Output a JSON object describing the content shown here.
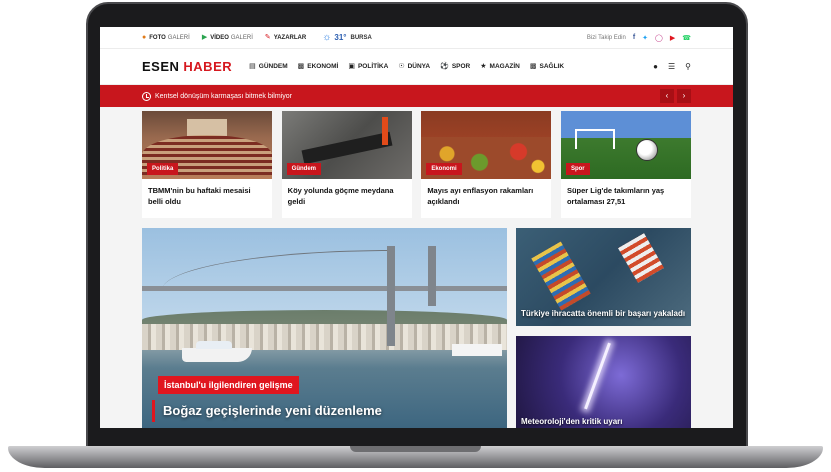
{
  "topbar": {
    "links": [
      {
        "icon": "camera-icon",
        "label": "FOTO",
        "sub": "GALERİ"
      },
      {
        "icon": "play-icon",
        "label": "VİDEO",
        "sub": "GALERİ"
      },
      {
        "icon": "pen-icon",
        "label": "YAZARLAR",
        "sub": ""
      }
    ],
    "weather": {
      "temp": "31°",
      "city": "BURSA"
    },
    "follow_label": "Bizi Takip Edin",
    "social": [
      "facebook-icon",
      "twitter-icon",
      "instagram-icon",
      "youtube-icon",
      "whatsapp-icon"
    ]
  },
  "header": {
    "logo_part1": "ESEN",
    "logo_part2": "HABER",
    "nav": [
      {
        "icon": "newspaper-icon",
        "label": "GÜNDEM"
      },
      {
        "icon": "chart-icon",
        "label": "EKONOMİ"
      },
      {
        "icon": "ballot-icon",
        "label": "POLİTİKA"
      },
      {
        "icon": "globe-icon",
        "label": "DÜNYA"
      },
      {
        "icon": "football-icon",
        "label": "SPOR"
      },
      {
        "icon": "star-icon",
        "label": "MAGAZİN"
      },
      {
        "icon": "medkit-icon",
        "label": "SAĞLIK"
      }
    ]
  },
  "breaking": {
    "text": "Kentsel dönüşüm karmaşası bitmek bilmiyor",
    "prev": "‹",
    "next": "›"
  },
  "cards": [
    {
      "category": "Politika",
      "title": "TBMM'nin bu haftaki mesaisi belli oldu"
    },
    {
      "category": "Gündem",
      "title": "Köy yolunda göçme meydana geldi"
    },
    {
      "category": "Ekonomi",
      "title": "Mayıs ayı enflasyon rakamları açıklandı"
    },
    {
      "category": "Spor",
      "title": "Süper Lig'de takımların yaş ortalaması 27,51"
    }
  ],
  "hero": {
    "tag": "İstanbul'u ilgilendiren gelişme",
    "headline": "Boğaz geçişlerinde yeni düzenleme"
  },
  "side": [
    {
      "title": "Türkiye ihracatta önemli bir başarı yakaladı"
    },
    {
      "title": "Meteoroloji'den kritik uyarı"
    }
  ],
  "colors": {
    "brand_red": "#c8161d",
    "accent_blue": "#2a5db0"
  }
}
